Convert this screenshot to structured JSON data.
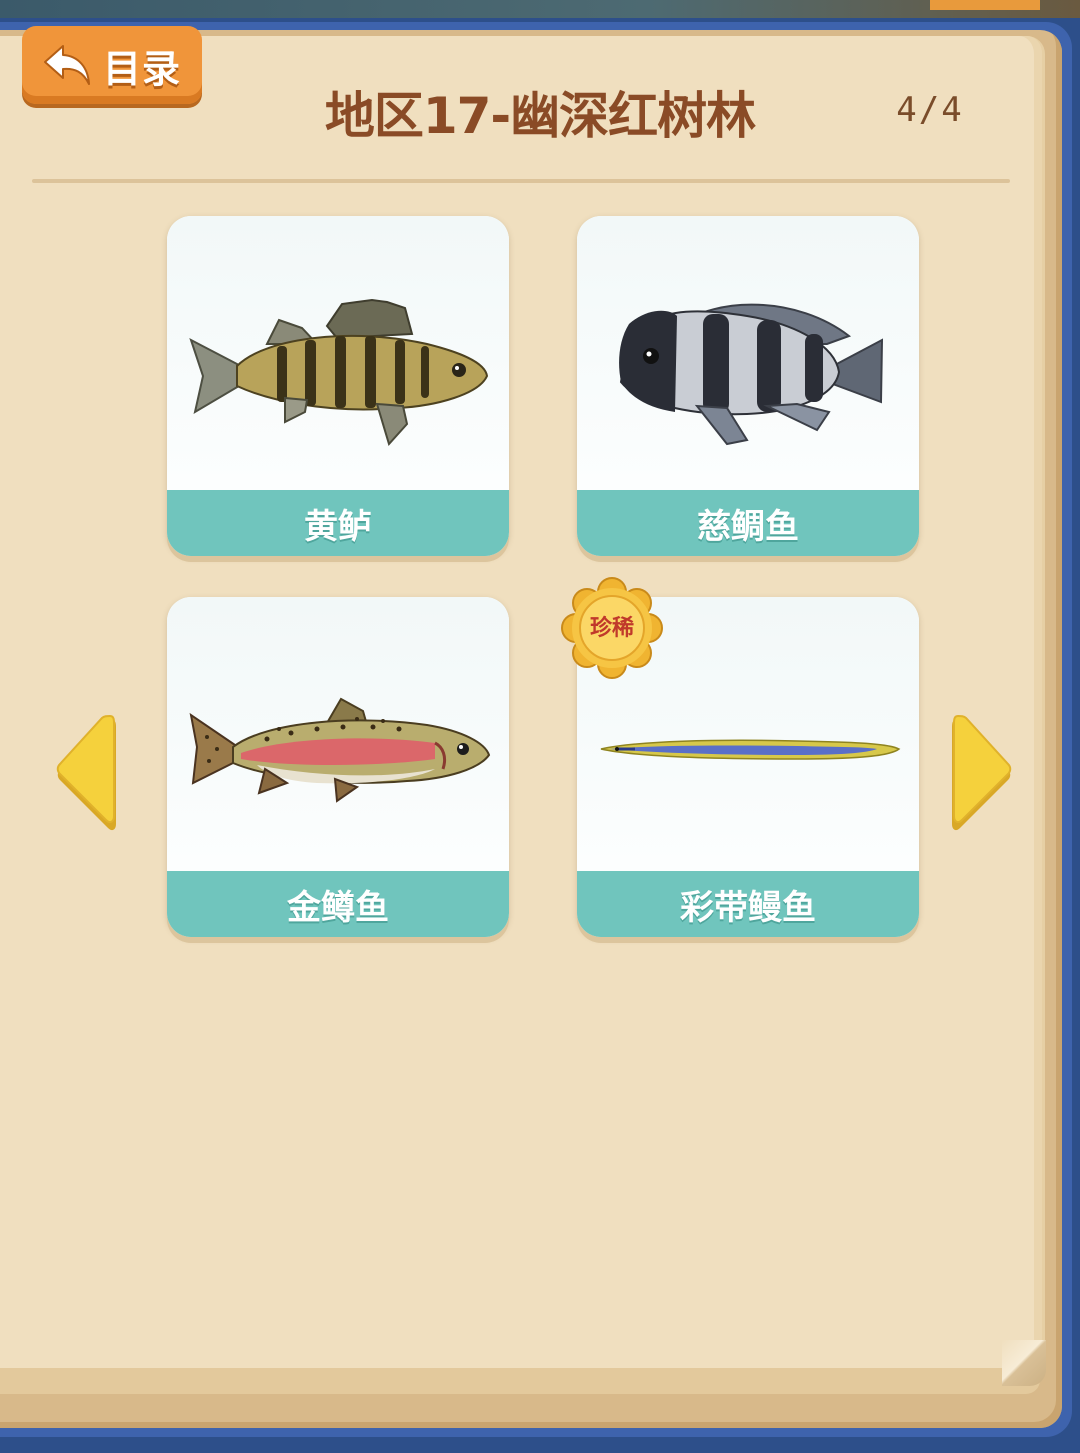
{
  "header": {
    "back_label": "目录",
    "title": "地区17-幽深红树林",
    "page_indicator": "4/4"
  },
  "fish": [
    {
      "name": "黄鲈",
      "rare": false
    },
    {
      "name": "慈鲷鱼",
      "rare": false
    },
    {
      "name": "金鳟鱼",
      "rare": false
    },
    {
      "name": "彩带鳗鱼",
      "rare": true,
      "badge_label": "珍稀"
    }
  ],
  "icons": {
    "back": "back-arrow-icon",
    "prev": "arrow-left-icon",
    "next": "arrow-right-icon"
  },
  "colors": {
    "name_bar": "#70c5bd",
    "back_button": "#f0953a",
    "title": "#8a4b26",
    "page": "#f0dfbf",
    "arrow": "#f5d13c"
  }
}
